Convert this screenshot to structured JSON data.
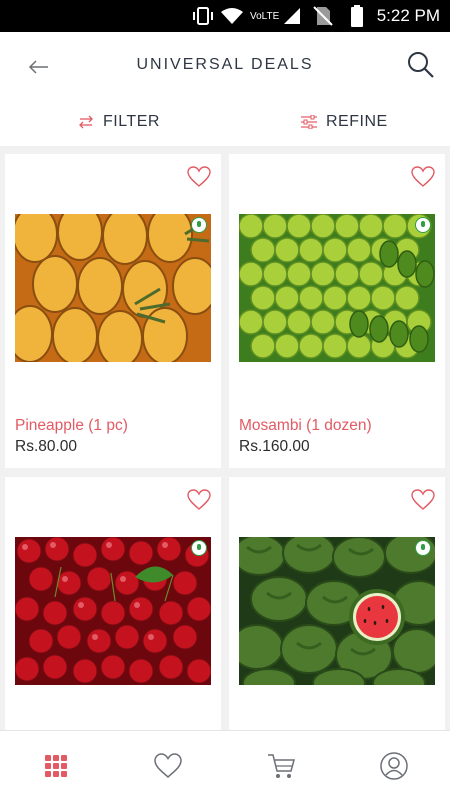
{
  "status_bar": {
    "network": "VoLTE",
    "time": "5:22 PM"
  },
  "header": {
    "title": "UNIVERSAL DEALS",
    "back_icon": "back-arrow-icon",
    "search_icon": "search-icon"
  },
  "toolbar": {
    "filter_label": "FILTER",
    "refine_label": "REFINE"
  },
  "products": [
    {
      "name": "Pineapple (1 pc)",
      "price": "Rs.80.00",
      "image": "pineapple-image"
    },
    {
      "name": "Mosambi (1 dozen)",
      "price": "Rs.160.00",
      "image": "mosambi-image"
    },
    {
      "name": "",
      "price": "",
      "image": "cherries-image"
    },
    {
      "name": "",
      "price": "",
      "image": "watermelon-image"
    }
  ],
  "bottom_nav": [
    {
      "icon": "grid-icon",
      "active": true
    },
    {
      "icon": "heart-icon",
      "active": false
    },
    {
      "icon": "cart-icon",
      "active": false
    },
    {
      "icon": "profile-icon",
      "active": false
    }
  ],
  "colors": {
    "accent": "#e25a63",
    "text": "#2f3744",
    "background": "#f1f1f1"
  }
}
